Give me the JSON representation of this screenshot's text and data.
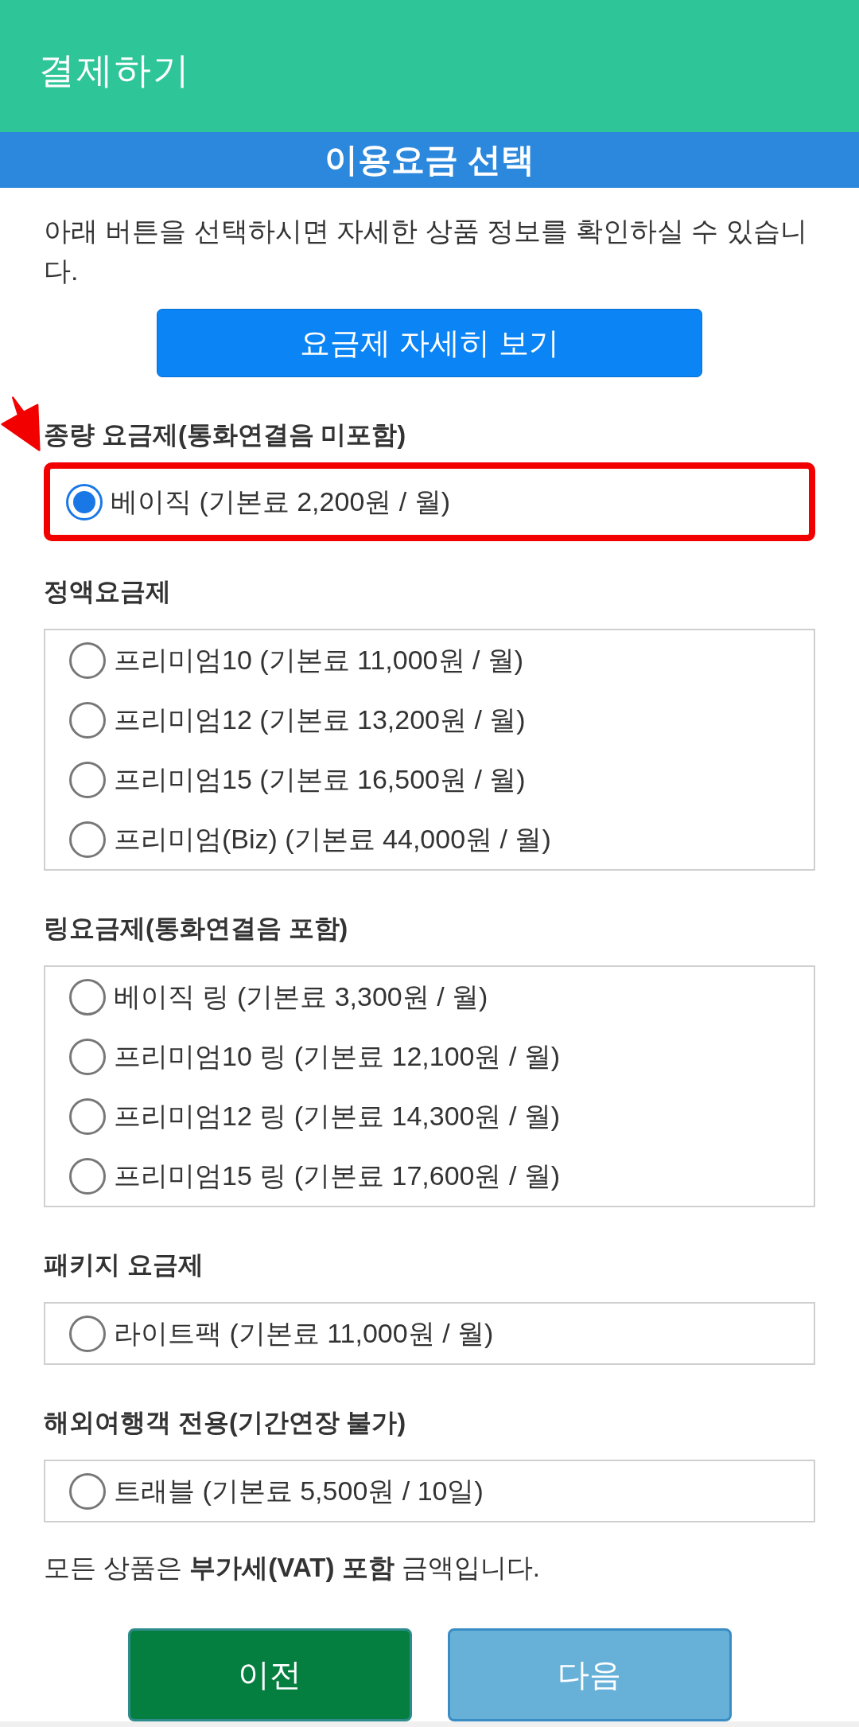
{
  "app_bar": {
    "title": "결제하기"
  },
  "banner": {
    "title": "이용요금 선택"
  },
  "intro": "아래 버튼을 선택하시면 자세한 상품 정보를 확인하실 수 있습니다.",
  "details_button": "요금제 자세히 보기",
  "plan_groups": [
    {
      "heading": "종량 요금제(통화연결음 미포함)",
      "highlighted": true,
      "options": [
        {
          "label": "베이직 (기본료 2,200원 / 월)",
          "selected": true
        }
      ]
    },
    {
      "heading": "정액요금제",
      "highlighted": false,
      "options": [
        {
          "label": "프리미엄10 (기본료 11,000원 / 월)",
          "selected": false
        },
        {
          "label": "프리미엄12 (기본료 13,200원 / 월)",
          "selected": false
        },
        {
          "label": "프리미엄15 (기본료 16,500원 / 월)",
          "selected": false
        },
        {
          "label": "프리미엄(Biz) (기본료 44,000원 / 월)",
          "selected": false
        }
      ]
    },
    {
      "heading": "링요금제(통화연결음 포함)",
      "highlighted": false,
      "options": [
        {
          "label": "베이직 링 (기본료 3,300원 / 월)",
          "selected": false
        },
        {
          "label": "프리미엄10 링 (기본료 12,100원 / 월)",
          "selected": false
        },
        {
          "label": "프리미엄12 링 (기본료 14,300원 / 월)",
          "selected": false
        },
        {
          "label": "프리미엄15 링 (기본료 17,600원 / 월)",
          "selected": false
        }
      ]
    },
    {
      "heading": "패키지 요금제",
      "highlighted": false,
      "options": [
        {
          "label": "라이트팩 (기본료 11,000원 / 월)",
          "selected": false
        }
      ]
    },
    {
      "heading": "해외여행객 전용(기간연장 불가)",
      "highlighted": false,
      "options": [
        {
          "label": "트래블 (기본료 5,500원 / 10일)",
          "selected": false
        }
      ]
    }
  ],
  "note": "모든 상품은 **부가세(VAT) 포함** 금액입니다.",
  "buttons": [
    {
      "label": "이전",
      "kind": "back"
    },
    {
      "label": "다음",
      "kind": "next"
    }
  ]
}
